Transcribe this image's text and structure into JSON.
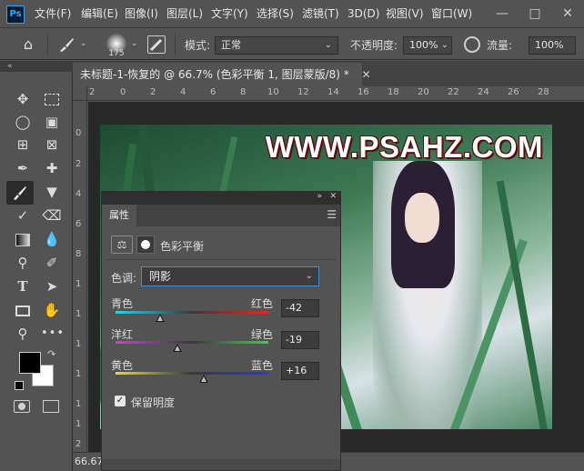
{
  "app": {
    "logo": "Ps",
    "menus": [
      "文件(F)",
      "编辑(E)",
      "图像(I)",
      "图层(L)",
      "文字(Y)",
      "选择(S)",
      "滤镜(T)",
      "3D(D)",
      "视图(V)",
      "窗口(W)"
    ],
    "window_controls": [
      "minimize-icon",
      "maximize-icon",
      "close-icon"
    ]
  },
  "options": {
    "brush_size": "175",
    "mode_label": "模式:",
    "mode_value": "正常",
    "opacity_label": "不透明度:",
    "opacity_value": "100%",
    "flow_label": "流量:",
    "flow_value": "100%"
  },
  "document": {
    "tab_title": "未标题-1-恢复的 @ 66.7% (色彩平衡 1, 图层蒙版/8) *",
    "zoom": "66.67",
    "watermark": "WWW.PSAHZ.COM",
    "ruler_h": [
      "2",
      "0",
      "2",
      "4",
      "6",
      "8",
      "10",
      "12",
      "14",
      "16",
      "18",
      "20",
      "22",
      "24",
      "26",
      "28"
    ],
    "ruler_v": [
      "0",
      "2",
      "4",
      "6",
      "8",
      "1",
      "1",
      "1",
      "1",
      "1",
      "1",
      "2"
    ]
  },
  "properties": {
    "tab_label": "属性",
    "section_title": "色彩平衡",
    "tone_label": "色调:",
    "tone_value": "阴影",
    "sliders": [
      {
        "left": "青色",
        "right": "红色",
        "value": "-42",
        "amount": -42
      },
      {
        "left": "洋红",
        "right": "绿色",
        "value": "-19",
        "amount": -19
      },
      {
        "left": "黄色",
        "right": "蓝色",
        "value": "+16",
        "amount": 16
      }
    ],
    "preserve_label": "保留明度",
    "preserve_checked": true
  },
  "colors": {
    "foreground": "#000000",
    "background": "#ffffff",
    "accent": "#31a8ff"
  }
}
